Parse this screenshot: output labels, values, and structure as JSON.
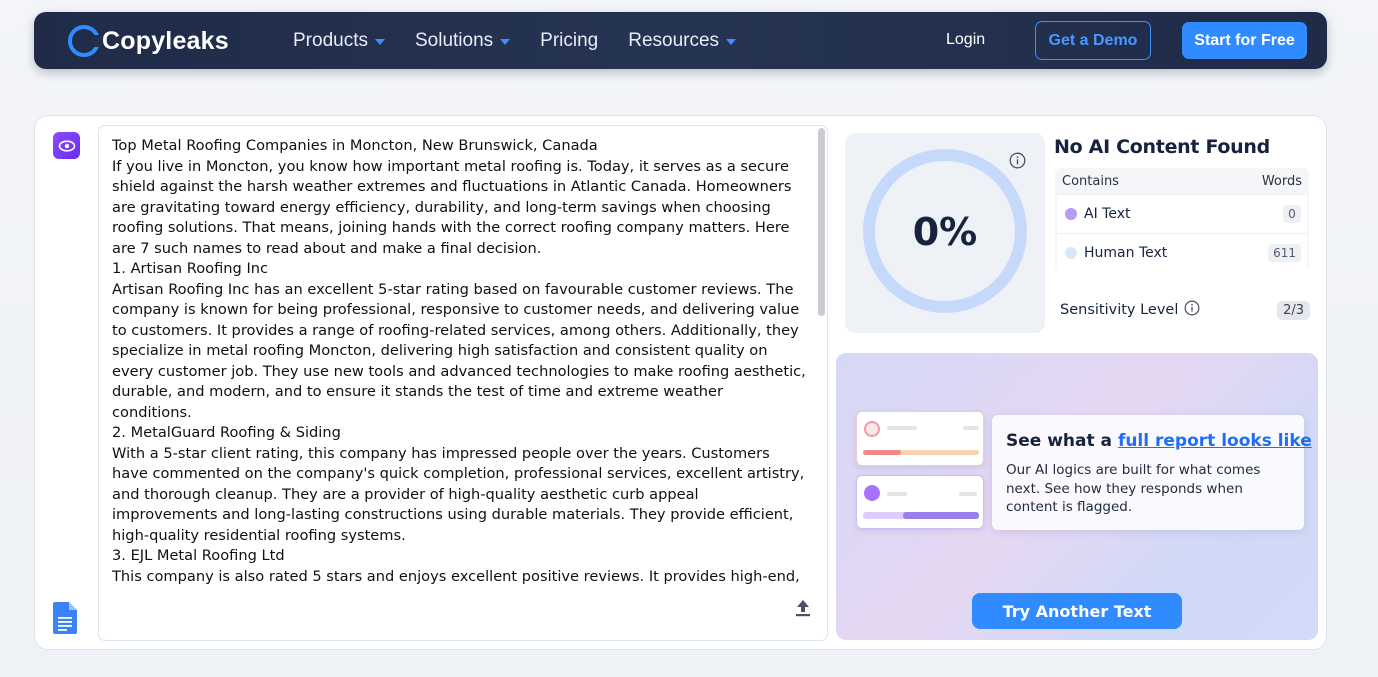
{
  "nav": {
    "logo_text": "Copyleaks",
    "menu": [
      {
        "label": "Products",
        "has_dropdown": true
      },
      {
        "label": "Solutions",
        "has_dropdown": true
      },
      {
        "label": "Pricing",
        "has_dropdown": false
      },
      {
        "label": "Resources",
        "has_dropdown": true
      }
    ],
    "login": "Login",
    "demo_button": "Get a Demo",
    "start_button": "Start for Free"
  },
  "editor": {
    "text": "Top Metal Roofing Companies in Moncton, New Brunswick, Canada\nIf you live in Moncton, you know how important metal roofing is. Today, it serves as a secure shield against the harsh weather extremes and fluctuations in Atlantic Canada. Homeowners are gravitating toward energy efficiency, durability, and long-term savings when choosing roofing solutions. That means, joining hands with the correct roofing company matters. Here are 7 such names to read about and make a final decision.\n1. Artisan Roofing Inc\nArtisan Roofing Inc has an excellent 5-star rating based on favourable customer reviews. The company is known for being professional, responsive to customer needs, and delivering value to customers. It provides a range of roofing-related services, among others. Additionally, they specialize in metal roofing Moncton, delivering high satisfaction and consistent quality on every customer job. They use new tools and advanced technologies to make roofing aesthetic, durable, and modern, and to ensure it stands the test of time and extreme weather conditions.\n2. MetalGuard Roofing & Siding\nWith a 5-star client rating, this company has impressed people over the years. Customers have commented on the company's quick completion, professional services, excellent artistry, and thorough cleanup. They are a provider of high-quality aesthetic curb appeal improvements and long-lasting constructions using durable materials. They provide efficient, high-quality residential roofing systems.\n3. EJL Metal Roofing Ltd\nThis company is also rated 5 stars and enjoys excellent positive reviews. It provides high-end, durable metal roofing, siding, soffit, and fascia year-round. EJL Metal Roofing has a reputation"
  },
  "result": {
    "percent": "0%",
    "percent_value": 0,
    "title": "No AI Content Found",
    "contains_header": "Contains",
    "words_header": "Words",
    "rows": [
      {
        "label": "AI Text",
        "count": "0",
        "color": "#b49cf2"
      },
      {
        "label": "Human Text",
        "count": "611",
        "color": "#dbe6fb"
      }
    ],
    "sensitivity_label": "Sensitivity Level",
    "sensitivity_value": "2/3"
  },
  "promo": {
    "title_prefix": "See what a ",
    "title_link": "full report looks like",
    "description": "Our AI logics are built for what comes next. See how they responds when content is flagged.",
    "try_button": "Try Another Text"
  },
  "colors": {
    "accent": "#2f8bff",
    "nav_bg": "#222f4d",
    "ring": "#c7d9fb"
  }
}
